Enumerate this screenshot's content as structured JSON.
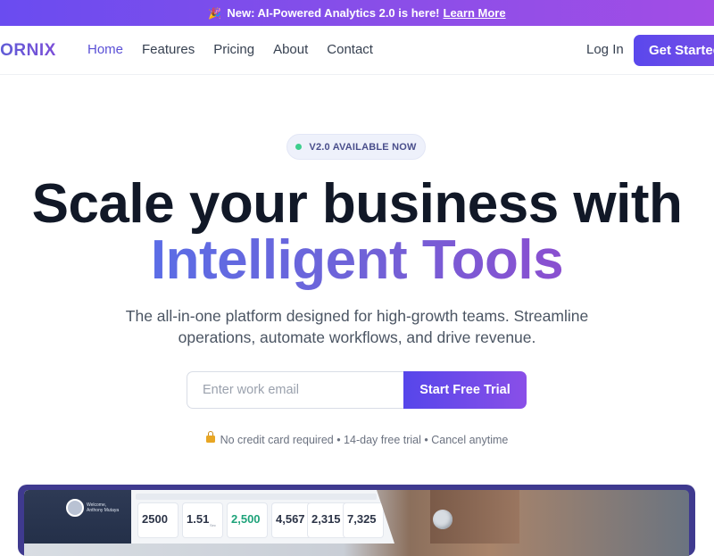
{
  "announcement": {
    "text": "New: AI-Powered Analytics 2.0 is here!",
    "link": "Learn More"
  },
  "nav": {
    "logo": "LORNIX",
    "links": [
      "Home",
      "Features",
      "Pricing",
      "About",
      "Contact"
    ],
    "active": "Home",
    "login": "Log In",
    "cta": "Get Started"
  },
  "hero": {
    "badge": "V2.0 AVAILABLE NOW",
    "title_line1": "Scale your business with",
    "title_line2": "Intelligent Tools",
    "subtitle": "The all-in-one platform designed for high-growth teams. Streamline operations, automate workflows, and drive revenue.",
    "email_placeholder": "Enter work email",
    "cta": "Start Free Trial",
    "note": "No credit card required • 14-day free trial • Cancel anytime"
  },
  "preview": {
    "user_greeting": "Welcome,",
    "user_name": "Anthony Mutaya",
    "stats": [
      "2500",
      "1.51",
      "2,500",
      "4,567",
      "2,315",
      "7,325"
    ],
    "stat_unit": "Sec"
  },
  "colors": {
    "accent": "#5b50d6",
    "gradient_start": "#5646ea",
    "gradient_end": "#8a4fe8",
    "heading": "#111827",
    "badge_dot": "#3ecf8e"
  },
  "icons": {
    "announcement": "party-popper-icon",
    "note": "lock-icon"
  }
}
